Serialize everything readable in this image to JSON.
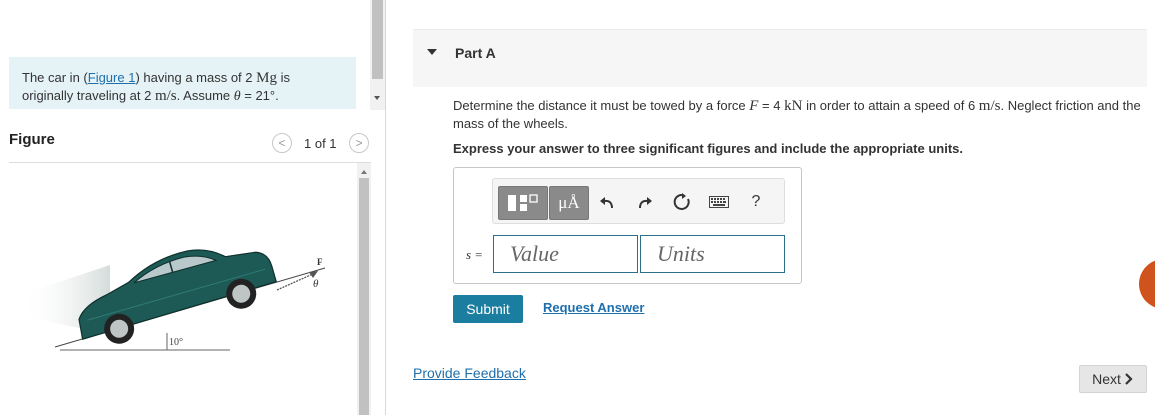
{
  "problem": {
    "text_1": "The car in (",
    "figure_link": "Figure 1",
    "text_2": ") having a mass of 2 ",
    "mass_unit": "Mg",
    "text_3": " is originally traveling at 2 ",
    "speed_unit": "m/s",
    "text_4": ". Assume ",
    "theta_symbol": "θ",
    "text_5": " = 21°."
  },
  "figure": {
    "title": "Figure",
    "pager": "1 of 1",
    "prev_glyph": "<",
    "next_glyph": ">",
    "force_label": "F",
    "angle_label": "θ",
    "slope_label": "10°",
    "car_color": "#1d5a55"
  },
  "part": {
    "label": "Part A",
    "question_1": "Determine the distance it must be towed by a force ",
    "force_symbol": "F",
    "question_2": " = 4 ",
    "force_unit": "kN",
    "question_3": " in order to attain a speed of 6 ",
    "speed_unit": "m/s",
    "question_4": ". Neglect friction and the mass of the wheels.",
    "instruction": "Express your answer to three significant figures and include the appropriate units."
  },
  "answer": {
    "var_label": "s =",
    "value_placeholder": "Value",
    "units_placeholder": "Units",
    "toolbar": {
      "units_button": "μÅ",
      "help": "?"
    }
  },
  "actions": {
    "submit": "Submit",
    "request": "Request Answer",
    "feedback": "Provide Feedback",
    "next": "Next"
  },
  "colors": {
    "accent": "#1b7ea0",
    "link": "#1f6fad",
    "problem_bg": "#e5f3f6",
    "fab": "#d0521c"
  }
}
